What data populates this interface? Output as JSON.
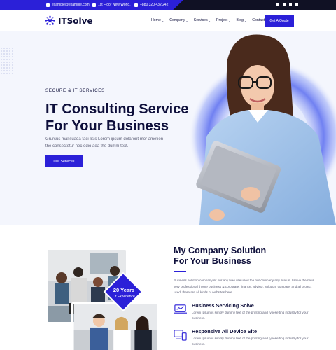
{
  "topbar": {
    "email": "example@example.com",
    "address": "1st Floor New World.",
    "phone": "+880 320 432 242",
    "social": [
      "facebook-icon",
      "twitter-icon",
      "instagram-icon",
      "pinterest-icon"
    ]
  },
  "header": {
    "logo_text": "ITSolve",
    "nav": [
      {
        "label": "Home",
        "has_dropdown": true
      },
      {
        "label": "Company",
        "has_dropdown": true
      },
      {
        "label": "Services",
        "has_dropdown": true
      },
      {
        "label": "Project",
        "has_dropdown": true
      },
      {
        "label": "Blog",
        "has_dropdown": true
      },
      {
        "label": "Contact",
        "has_dropdown": false
      }
    ],
    "cta_label": "Get A Quote",
    "chevron": "⌄"
  },
  "hero": {
    "eyebrow": "SECURE & IT SERVICES",
    "title_line1": "IT Consulting Service",
    "title_line2": "For Your Business",
    "description": "Grursus mal suada faci lisis Lorem ipsum dolarorit mor ametion the consectetur nec odio aea the dumm text.",
    "button_label": "Our Services"
  },
  "solution": {
    "badge_years": "20 Years",
    "badge_label": "Of Experience",
    "title_line1": "My Company Solution",
    "title_line2": "For Your Business",
    "description": "Business solution company sit our any how site used the our company any site us. Itsolve theme is very professional theme business & corporate, finance, advisor, solution, company and all project used, there are all kinds of websites here.",
    "features": [
      {
        "title": "Business Servicing Solve",
        "description": "Lorem Ipsum is simply dummy text of the printing and typesetting industry for your business."
      },
      {
        "title": "Responsive All Device Site",
        "description": "Lorem Ipsum is simply dummy text of the printing and typesetting industry for your business."
      }
    ]
  },
  "colors": {
    "brand": "#2b20d8",
    "dark": "#101124",
    "heading": "#0e0f3b",
    "hero_bg": "#f4f6fd"
  }
}
